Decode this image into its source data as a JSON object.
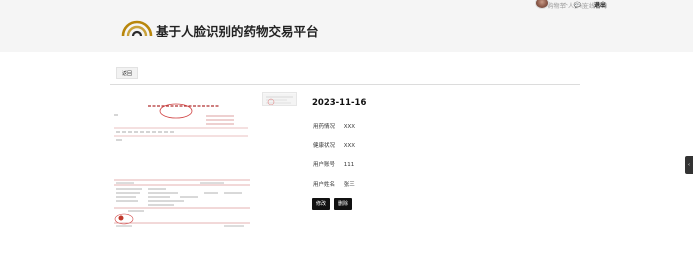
{
  "header": {
    "site_title": "基于人脸识别的药物交易平台",
    "nav": [
      {
        "label": "购物车",
        "icon": "cart-icon"
      },
      {
        "label": "在线咨询",
        "icon": "chat-icon"
      }
    ],
    "user_center": "个人中心",
    "logout": "退出"
  },
  "main": {
    "back_label": "返回",
    "detail": {
      "date": "2023-11-16",
      "fields": [
        {
          "label": "用药情况",
          "value": "XXX"
        },
        {
          "label": "健康状况",
          "value": "XXX"
        },
        {
          "label": "用户账号",
          "value": "111"
        },
        {
          "label": "用户姓名",
          "value": "张三"
        }
      ],
      "buttons": {
        "edit": "修改",
        "delete": "删除"
      }
    }
  },
  "side_tab": {
    "icon": "chevron-left-icon"
  },
  "colors": {
    "header_bg": "#f5f5f5",
    "logo_gold": "#b8860b",
    "button_bg": "#111111",
    "stamp_red": "#c0392b"
  }
}
